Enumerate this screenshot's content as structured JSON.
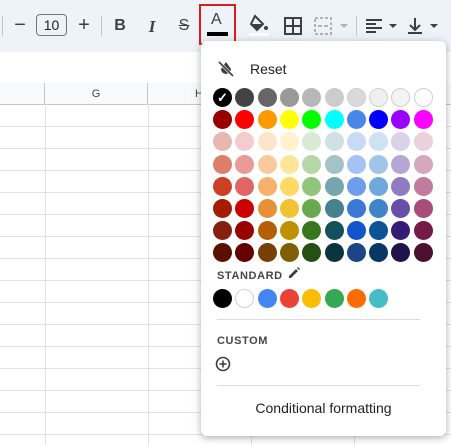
{
  "toolbar": {
    "decrease_font_glyph": "−",
    "font_size_value": "10",
    "increase_font_glyph": "+",
    "bold_glyph": "B",
    "italic_glyph": "I",
    "strike_glyph": "S",
    "text_color_glyph": "A",
    "text_color_bar": "#000000"
  },
  "sheet": {
    "columns": [
      "G",
      "H"
    ]
  },
  "color_menu": {
    "reset_label": "Reset",
    "selected_color": "#000000",
    "palette_rows": [
      [
        "#000000",
        "#434343",
        "#666666",
        "#999999",
        "#b7b7b7",
        "#cccccc",
        "#d9d9d9",
        "#efefef",
        "#f3f3f3",
        "#ffffff"
      ],
      [
        "#980000",
        "#ff0000",
        "#ff9900",
        "#ffff00",
        "#00ff00",
        "#00ffff",
        "#4a86e8",
        "#0000ff",
        "#9900ff",
        "#ff00ff"
      ],
      [
        "#e6b8af",
        "#f4cccc",
        "#fce5cd",
        "#fff2cc",
        "#d9ead3",
        "#d0e0e3",
        "#c9daf8",
        "#cfe2f3",
        "#d9d2e9",
        "#ead1dc"
      ],
      [
        "#dd7e6b",
        "#ea9999",
        "#f9cb9c",
        "#ffe599",
        "#b6d7a8",
        "#a2c4c9",
        "#a4c2f4",
        "#9fc5e8",
        "#b4a7d6",
        "#d5a6bd"
      ],
      [
        "#cc4125",
        "#e06666",
        "#f6b26b",
        "#ffd966",
        "#93c47d",
        "#76a5af",
        "#6d9eeb",
        "#6fa8dc",
        "#8e7cc3",
        "#c27ba0"
      ],
      [
        "#a61c00",
        "#cc0000",
        "#e69138",
        "#f1c232",
        "#6aa84f",
        "#45818e",
        "#3c78d8",
        "#3d85c6",
        "#674ea7",
        "#a64d79"
      ],
      [
        "#85200c",
        "#990000",
        "#b45f06",
        "#bf9000",
        "#38761d",
        "#134f5c",
        "#1155cc",
        "#0b5394",
        "#351c75",
        "#741b47"
      ],
      [
        "#5b0f00",
        "#660000",
        "#783f04",
        "#7f6000",
        "#274e13",
        "#0c343d",
        "#1c4587",
        "#073763",
        "#20124d",
        "#4c1130"
      ]
    ],
    "standard_label": "STANDARD",
    "standard_colors": [
      "#000000",
      "#ffffff",
      "#4285f4",
      "#ea4335",
      "#fbbc04",
      "#34a853",
      "#ff6d01",
      "#46bdc6"
    ],
    "custom_label": "CUSTOM",
    "conditional_formatting_label": "Conditional formatting"
  }
}
